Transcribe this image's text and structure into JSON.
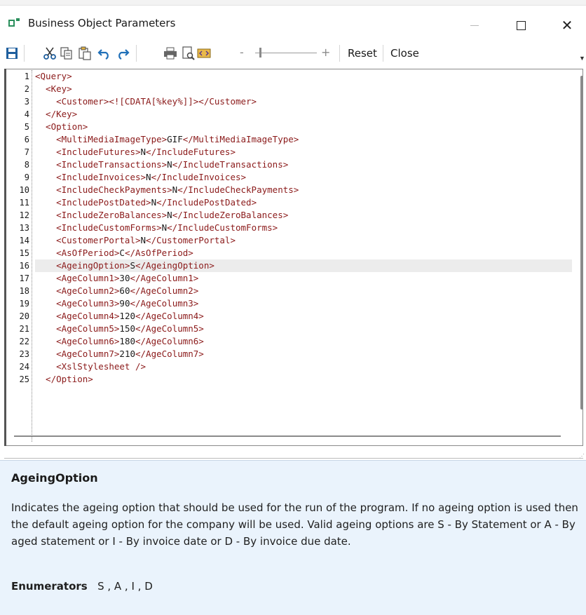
{
  "window": {
    "title": "Business Object Parameters",
    "close_glyph": "✕"
  },
  "toolbar": {
    "reset_label": "Reset",
    "close_label": "Close",
    "zoom_minus": "-",
    "zoom_plus": "+",
    "zoom_level": 0.05
  },
  "editor": {
    "line_numbers": [
      "1",
      "2",
      "3",
      "4",
      "5",
      "6",
      "7",
      "8",
      "9",
      "10",
      "11",
      "12",
      "13",
      "14",
      "15",
      "16",
      "17",
      "18",
      "19",
      "20",
      "21",
      "22",
      "23",
      "24",
      "25"
    ],
    "highlighted_line": 16,
    "lines": [
      [
        {
          "t": "tag",
          "v": "<Query>"
        }
      ],
      [
        {
          "t": "tag",
          "v": "  <Key>"
        }
      ],
      [
        {
          "t": "tag",
          "v": "    <Customer><![CDATA[%key%]]></Customer>"
        }
      ],
      [
        {
          "t": "tag",
          "v": "  </Key>"
        }
      ],
      [
        {
          "t": "tag",
          "v": "  <Option>"
        }
      ],
      [
        {
          "t": "tag",
          "v": "    <MultiMediaImageType>"
        },
        {
          "t": "txt",
          "v": "GIF"
        },
        {
          "t": "tag",
          "v": "</MultiMediaImageType>"
        }
      ],
      [
        {
          "t": "tag",
          "v": "    <IncludeFutures>"
        },
        {
          "t": "txt",
          "v": "N"
        },
        {
          "t": "tag",
          "v": "</IncludeFutures>"
        }
      ],
      [
        {
          "t": "tag",
          "v": "    <IncludeTransactions>"
        },
        {
          "t": "txt",
          "v": "N"
        },
        {
          "t": "tag",
          "v": "</IncludeTransactions>"
        }
      ],
      [
        {
          "t": "tag",
          "v": "    <IncludeInvoices>"
        },
        {
          "t": "txt",
          "v": "N"
        },
        {
          "t": "tag",
          "v": "</IncludeInvoices>"
        }
      ],
      [
        {
          "t": "tag",
          "v": "    <IncludeCheckPayments>"
        },
        {
          "t": "txt",
          "v": "N"
        },
        {
          "t": "tag",
          "v": "</IncludeCheckPayments>"
        }
      ],
      [
        {
          "t": "tag",
          "v": "    <IncludePostDated>"
        },
        {
          "t": "txt",
          "v": "N"
        },
        {
          "t": "tag",
          "v": "</IncludePostDated>"
        }
      ],
      [
        {
          "t": "tag",
          "v": "    <IncludeZeroBalances>"
        },
        {
          "t": "txt",
          "v": "N"
        },
        {
          "t": "tag",
          "v": "</IncludeZeroBalances>"
        }
      ],
      [
        {
          "t": "tag",
          "v": "    <IncludeCustomForms>"
        },
        {
          "t": "txt",
          "v": "N"
        },
        {
          "t": "tag",
          "v": "</IncludeCustomForms>"
        }
      ],
      [
        {
          "t": "tag",
          "v": "    <CustomerPortal>"
        },
        {
          "t": "txt",
          "v": "N"
        },
        {
          "t": "tag",
          "v": "</CustomerPortal>"
        }
      ],
      [
        {
          "t": "tag",
          "v": "    <AsOfPeriod>"
        },
        {
          "t": "txt",
          "v": "C"
        },
        {
          "t": "tag",
          "v": "</AsOfPeriod>"
        }
      ],
      [
        {
          "t": "tag",
          "v": "    <AgeingOption>"
        },
        {
          "t": "txt",
          "v": "S"
        },
        {
          "t": "tag",
          "v": "</AgeingOption>"
        }
      ],
      [
        {
          "t": "tag",
          "v": "    <AgeColumn1>"
        },
        {
          "t": "txt",
          "v": "30"
        },
        {
          "t": "tag",
          "v": "</AgeColumn1>"
        }
      ],
      [
        {
          "t": "tag",
          "v": "    <AgeColumn2>"
        },
        {
          "t": "txt",
          "v": "60"
        },
        {
          "t": "tag",
          "v": "</AgeColumn2>"
        }
      ],
      [
        {
          "t": "tag",
          "v": "    <AgeColumn3>"
        },
        {
          "t": "txt",
          "v": "90"
        },
        {
          "t": "tag",
          "v": "</AgeColumn3>"
        }
      ],
      [
        {
          "t": "tag",
          "v": "    <AgeColumn4>"
        },
        {
          "t": "txt",
          "v": "120"
        },
        {
          "t": "tag",
          "v": "</AgeColumn4>"
        }
      ],
      [
        {
          "t": "tag",
          "v": "    <AgeColumn5>"
        },
        {
          "t": "txt",
          "v": "150"
        },
        {
          "t": "tag",
          "v": "</AgeColumn5>"
        }
      ],
      [
        {
          "t": "tag",
          "v": "    <AgeColumn6>"
        },
        {
          "t": "txt",
          "v": "180"
        },
        {
          "t": "tag",
          "v": "</AgeColumn6>"
        }
      ],
      [
        {
          "t": "tag",
          "v": "    <AgeColumn7>"
        },
        {
          "t": "txt",
          "v": "210"
        },
        {
          "t": "tag",
          "v": "</AgeColumn7>"
        }
      ],
      [
        {
          "t": "tag",
          "v": "    <XslStylesheet />"
        }
      ],
      [
        {
          "t": "tag",
          "v": "  </Option>"
        }
      ]
    ]
  },
  "help": {
    "title": "AgeingOption",
    "description": "Indicates the ageing option that should be used for the run of the program. If no ageing option is used then the default ageing option for the company will be used. Valid ageing options are S - By Statement or A - By aged statement or I - By invoice date or D - By invoice due date.",
    "enumerators_label": "Enumerators",
    "enumerators_values": "S , A , I , D"
  },
  "colors": {
    "tag": "#8b1a1a",
    "text": "#1a1a1a",
    "help_bg": "#eaf3fc",
    "save_icon": "#1f5f9e",
    "undo_icon": "#1f6fb8",
    "app_icon": "#2a8f5c"
  },
  "icons": [
    "app-icon",
    "save-icon",
    "cut-icon",
    "copy-icon",
    "paste-icon",
    "undo-icon",
    "redo-icon",
    "print-icon",
    "print-preview-icon",
    "xml-view-icon",
    "minimize-icon",
    "maximize-icon",
    "close-icon"
  ]
}
